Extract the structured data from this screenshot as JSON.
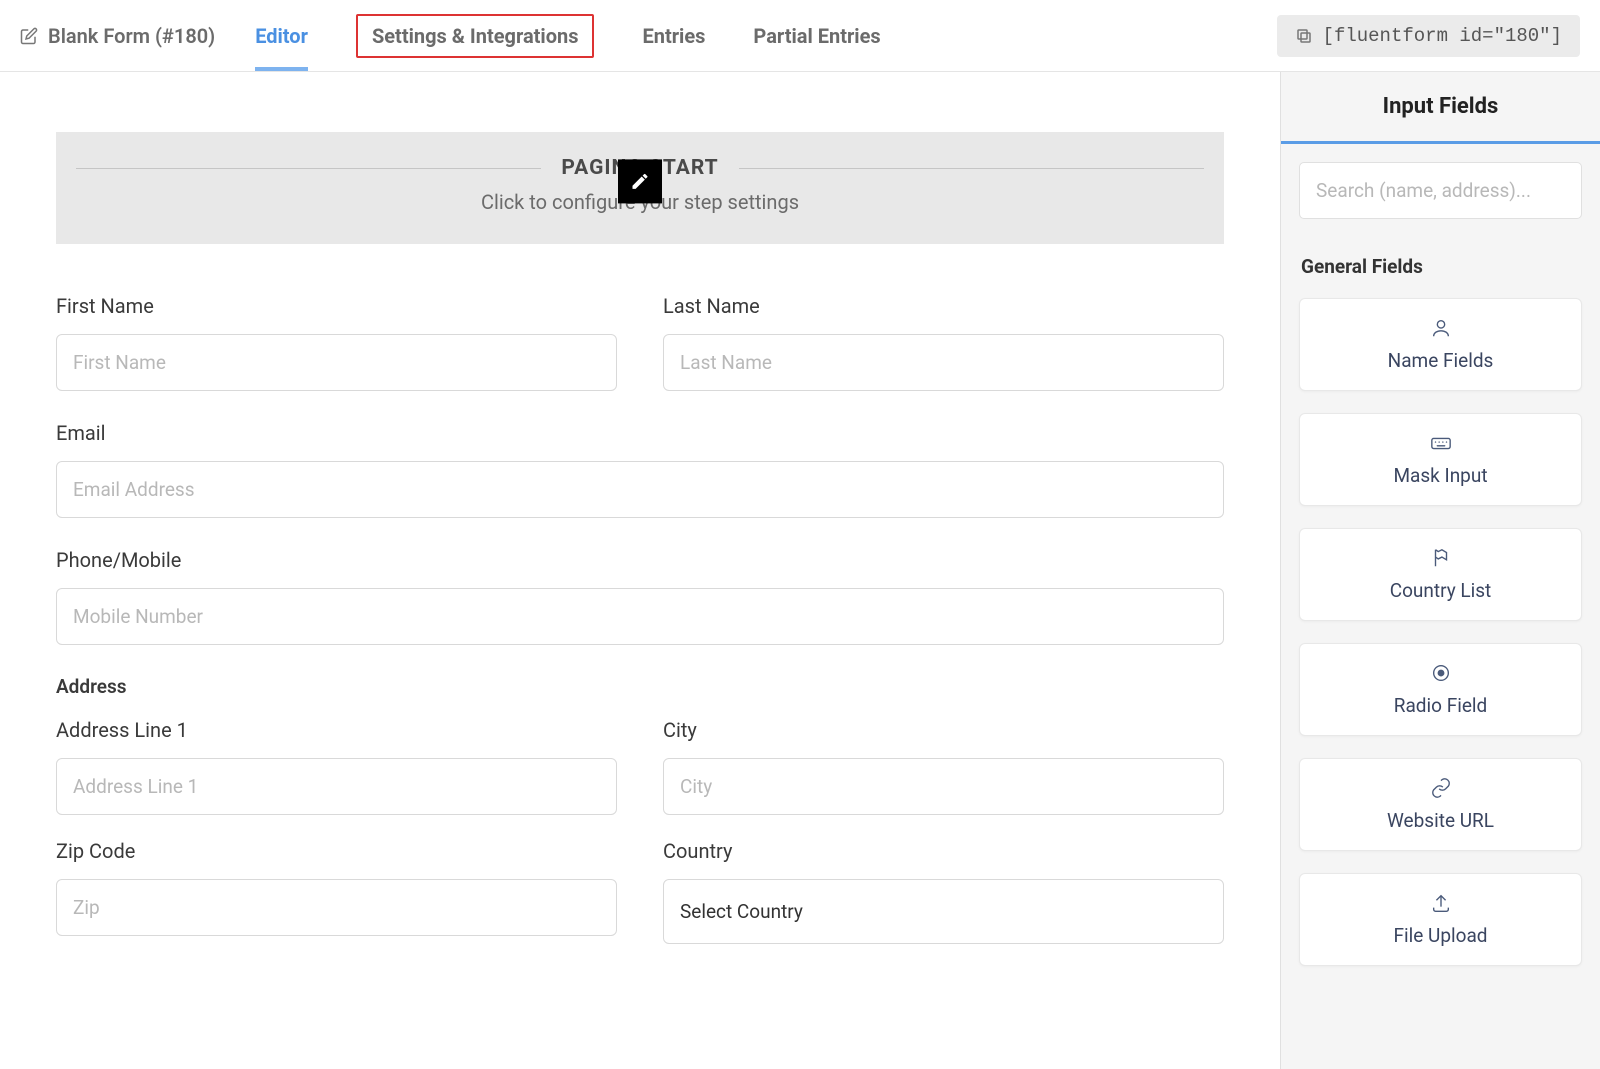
{
  "header": {
    "form_title": "Blank Form (#180)",
    "shortcode": "[fluentform id=\"180\"]"
  },
  "nav": {
    "tabs": [
      {
        "label": "Editor",
        "active": true,
        "highlighted": false
      },
      {
        "label": "Settings & Integrations",
        "active": false,
        "highlighted": true
      },
      {
        "label": "Entries",
        "active": false,
        "highlighted": false
      },
      {
        "label": "Partial Entries",
        "active": false,
        "highlighted": false
      }
    ]
  },
  "paging": {
    "title": "PAGING START",
    "subtitle": "Click to configure your step settings"
  },
  "form": {
    "first_name": {
      "label": "First Name",
      "placeholder": "First Name"
    },
    "last_name": {
      "label": "Last Name",
      "placeholder": "Last Name"
    },
    "email": {
      "label": "Email",
      "placeholder": "Email Address"
    },
    "phone": {
      "label": "Phone/Mobile",
      "placeholder": "Mobile Number"
    },
    "address_section": "Address",
    "address1": {
      "label": "Address Line 1",
      "placeholder": "Address Line 1"
    },
    "city": {
      "label": "City",
      "placeholder": "City"
    },
    "zip": {
      "label": "Zip Code",
      "placeholder": "Zip"
    },
    "country": {
      "label": "Country",
      "placeholder": "Select Country"
    }
  },
  "sidebar": {
    "title": "Input Fields",
    "search_placeholder": "Search (name, address)...",
    "section_title": "General Fields",
    "fields": [
      {
        "label": "Name Fields",
        "icon": "user-icon"
      },
      {
        "label": "Mask Input",
        "icon": "keyboard-icon"
      },
      {
        "label": "Country List",
        "icon": "flag-icon"
      },
      {
        "label": "Radio Field",
        "icon": "radio-icon"
      },
      {
        "label": "Website URL",
        "icon": "link-icon"
      },
      {
        "label": "File Upload",
        "icon": "upload-icon"
      }
    ]
  }
}
